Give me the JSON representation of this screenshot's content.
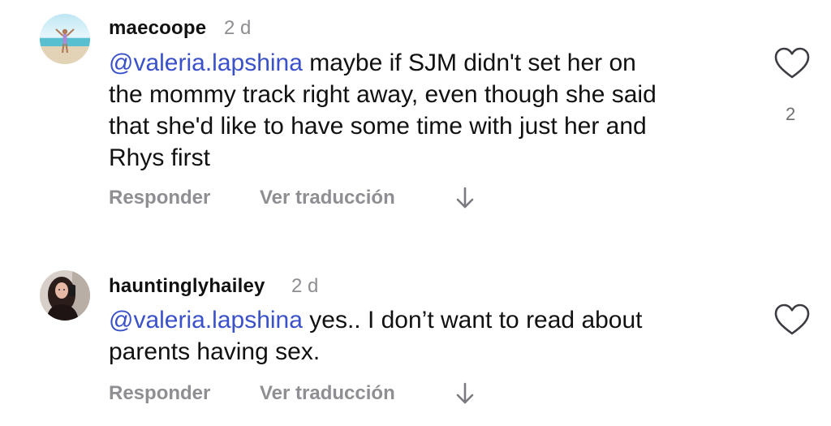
{
  "comments": [
    {
      "username": "maecoope",
      "time": "2 d",
      "mention": "@valeria.lapshina",
      "lines": [
        " maybe if SJM didn't set her on",
        "the mommy track right away, even though she said",
        "that she'd like to have some time with just her and",
        "Rhys first"
      ],
      "reply_label": "Responder",
      "translate_label": "Ver traducción",
      "like_count": "2",
      "avatar_icon": "beach-photo-avatar"
    },
    {
      "username": "hauntinglyhailey",
      "time": "2 d",
      "mention": "@valeria.lapshina",
      "lines": [
        " yes.. I don’t want to read about",
        "parents having sex."
      ],
      "reply_label": "Responder",
      "translate_label": "Ver traducción",
      "like_count": "",
      "avatar_icon": "selfie-photo-avatar"
    }
  ],
  "colors": {
    "mention": "#3a51c9",
    "secondary": "#8e8e93",
    "text": "#111111"
  }
}
